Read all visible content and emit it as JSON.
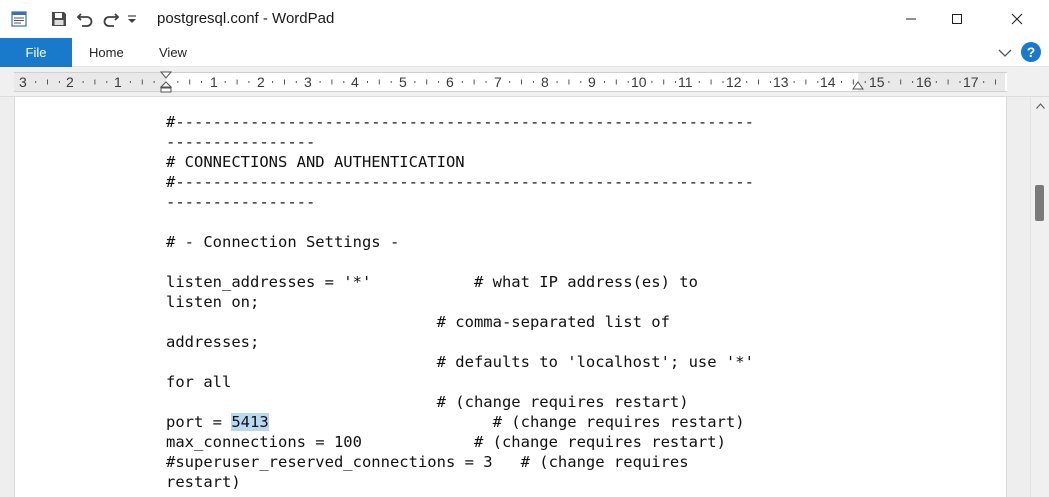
{
  "window": {
    "title": "postgresql.conf - WordPad"
  },
  "ribbon": {
    "tabs": [
      {
        "label": "File",
        "active": true
      },
      {
        "label": "Home"
      },
      {
        "label": "View"
      }
    ],
    "help_label": "?"
  },
  "ruler": {
    "labels": [
      "3",
      "2",
      "1",
      "1",
      "2",
      "3",
      "4",
      "5",
      "6",
      "7",
      "8",
      "9",
      "10",
      "11",
      "12",
      "13",
      "14",
      "15",
      "16",
      "17"
    ]
  },
  "document": {
    "lines": [
      "#--------------------------------------------------------------",
      "----------------",
      "# CONNECTIONS AND AUTHENTICATION",
      "#--------------------------------------------------------------",
      "----------------",
      "",
      "# - Connection Settings -",
      "",
      "listen_addresses = '*'           # what IP address(es) to",
      "listen on;",
      "                             # comma-separated list of",
      "addresses;",
      "                             # defaults to 'localhost'; use '*'",
      "for all",
      "                             # (change requires restart)",
      "port = 5413                        # (change requires restart)",
      "max_connections = 100            # (change requires restart)",
      "#superuser_reserved_connections = 3   # (change requires",
      "restart)"
    ],
    "port_line": {
      "prefix": "port = ",
      "selected": "5413",
      "suffix": "                        # (change requires restart)"
    }
  },
  "colors": {
    "accent": "#1979ca",
    "selection": "#b9d8f2"
  },
  "icons": [
    "wordpad-app-icon",
    "save-icon",
    "undo-icon",
    "redo-icon",
    "customize-quick-access-icon",
    "minimize-icon",
    "maximize-icon",
    "close-icon",
    "collapse-ribbon-icon",
    "help-icon",
    "scroll-up-icon"
  ]
}
